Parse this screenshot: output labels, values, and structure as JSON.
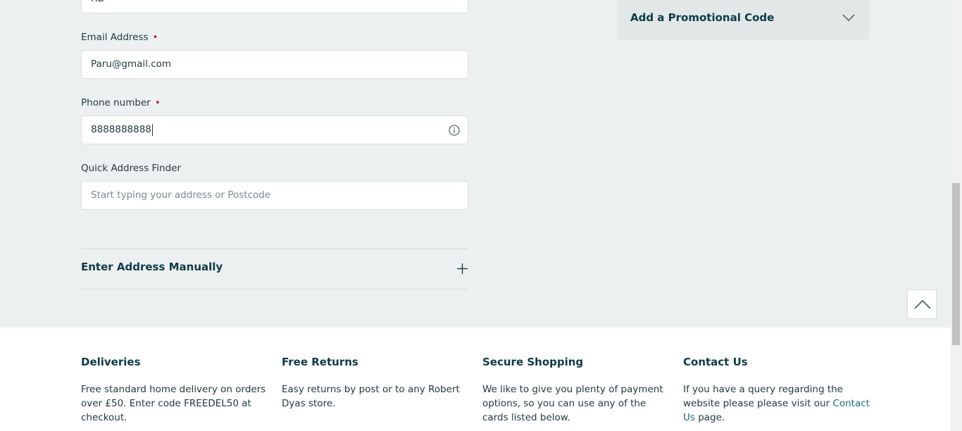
{
  "form": {
    "last_name_value": "RD",
    "email": {
      "label": "Email Address",
      "required_mark": "•",
      "value": "Paru@gmail.com"
    },
    "phone": {
      "label": "Phone number",
      "required_mark": "•",
      "value": "8888888888"
    },
    "address_finder": {
      "label": "Quick Address Finder",
      "placeholder": "Start typing your address or Postcode"
    },
    "manual_address": {
      "label": "Enter Address Manually"
    }
  },
  "promo": {
    "label": "Add a Promotional Code"
  },
  "footer": {
    "deliveries": {
      "title": "Deliveries",
      "text": "Free standard home delivery on orders over £50. Enter code FREEDEL50 at checkout."
    },
    "returns": {
      "title": "Free Returns",
      "text": "Easy returns by post or to any Robert Dyas store."
    },
    "secure": {
      "title": "Secure Shopping",
      "text": "We like to give you plenty of payment options, so you can use any of the cards listed below."
    },
    "contact": {
      "title": "Contact Us",
      "text_before": "If you have a query regarding the website please please visit our ",
      "link": "Contact Us",
      "text_after": " page."
    }
  },
  "icons": {
    "info": "info-icon",
    "plus": "plus-icon",
    "chevron": "chevron-down-icon",
    "scroll_top": "chevron-up-icon"
  }
}
